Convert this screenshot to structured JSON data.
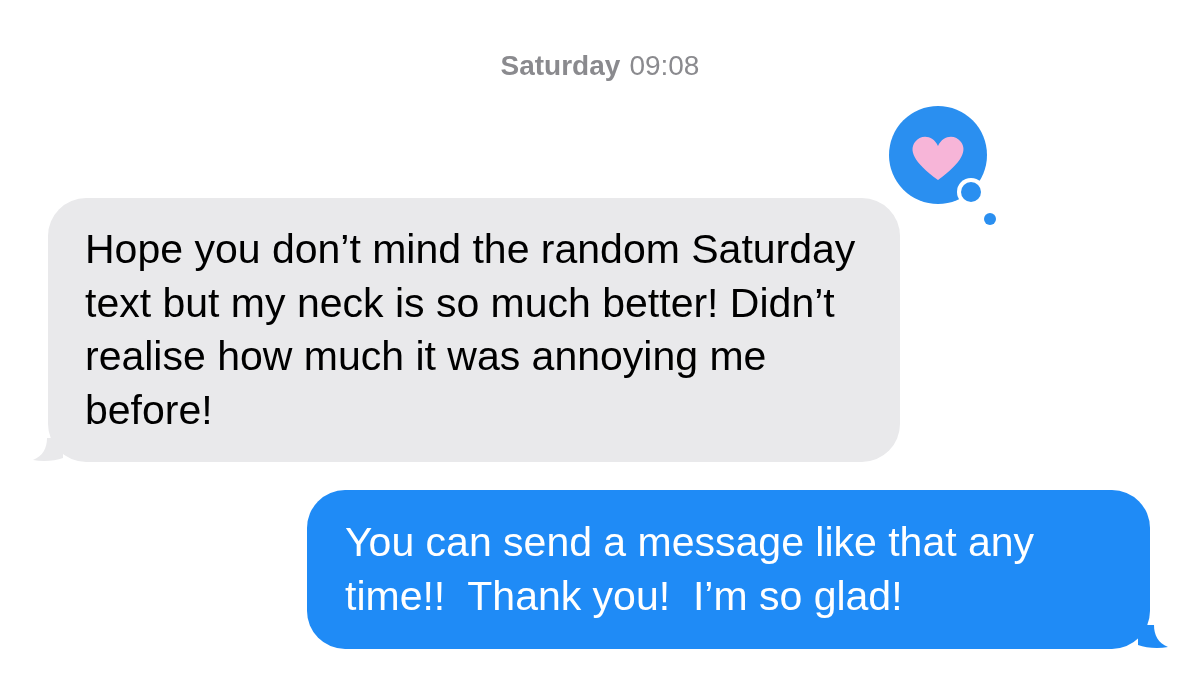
{
  "timestamp": {
    "day": "Saturday",
    "time": "09:08"
  },
  "messages": [
    {
      "kind": "received",
      "text": "Hope you don’t mind the random Saturday text but my neck is so much better! Didn’t realise how much it was annoying me before!",
      "reaction": {
        "kind": "heart"
      }
    },
    {
      "kind": "sent",
      "text": "You can send a message like that any time!!  Thank you!  I’m so glad!"
    }
  ]
}
